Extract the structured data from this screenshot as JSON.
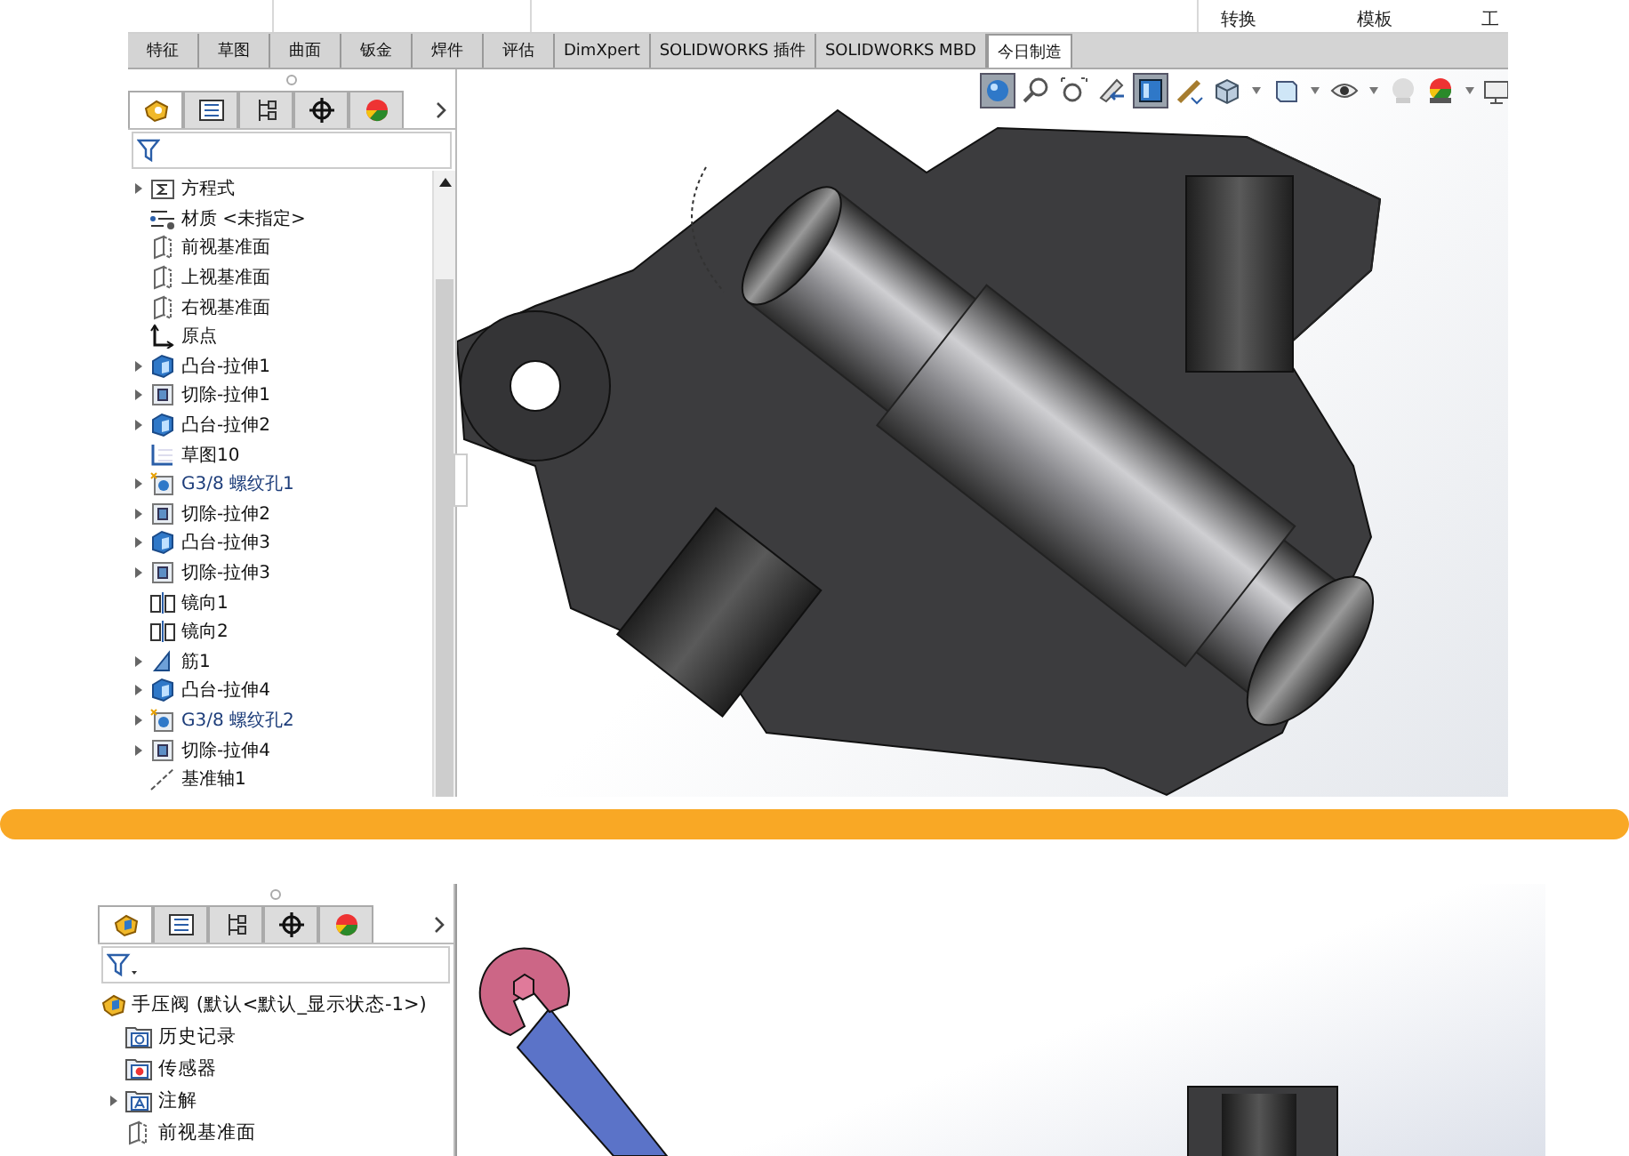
{
  "top_window": {
    "ribbon_labels": [
      "转换",
      "模板",
      "工"
    ],
    "tabs": [
      {
        "label": "特征",
        "selected": false
      },
      {
        "label": "草图",
        "selected": false
      },
      {
        "label": "曲面",
        "selected": false
      },
      {
        "label": "钣金",
        "selected": false
      },
      {
        "label": "焊件",
        "selected": false
      },
      {
        "label": "评估",
        "selected": false
      },
      {
        "label": "DimXpert",
        "selected": false
      },
      {
        "label": "SOLIDWORKS 插件",
        "selected": false
      },
      {
        "label": "SOLIDWORKS MBD",
        "selected": false
      },
      {
        "label": "今日制造",
        "selected": true
      }
    ],
    "panel_tabs": [
      {
        "kind": "part",
        "selected": true
      },
      {
        "kind": "property",
        "selected": false
      },
      {
        "kind": "config",
        "selected": false
      },
      {
        "kind": "origin",
        "selected": false
      },
      {
        "kind": "appearance",
        "selected": false
      }
    ],
    "tree": [
      {
        "label": "方程式",
        "kind": "equation",
        "expandable": true
      },
      {
        "label": "材质 <未指定>",
        "kind": "material",
        "expandable": false
      },
      {
        "label": "前视基准面",
        "kind": "plane",
        "expandable": false
      },
      {
        "label": "上视基准面",
        "kind": "plane",
        "expandable": false
      },
      {
        "label": "右视基准面",
        "kind": "plane",
        "expandable": false
      },
      {
        "label": "原点",
        "kind": "origin",
        "expandable": false
      },
      {
        "label": "凸台-拉伸1",
        "kind": "boss",
        "expandable": true
      },
      {
        "label": "切除-拉伸1",
        "kind": "cut",
        "expandable": true
      },
      {
        "label": "凸台-拉伸2",
        "kind": "boss",
        "expandable": true
      },
      {
        "label": "草图10",
        "kind": "sketch",
        "expandable": false
      },
      {
        "label": "G3/8 螺纹孔1",
        "kind": "hole",
        "expandable": true
      },
      {
        "label": "切除-拉伸2",
        "kind": "cut",
        "expandable": true
      },
      {
        "label": "凸台-拉伸3",
        "kind": "boss",
        "expandable": true
      },
      {
        "label": "切除-拉伸3",
        "kind": "cut",
        "expandable": true
      },
      {
        "label": "镜向1",
        "kind": "mirror",
        "expandable": false
      },
      {
        "label": "镜向2",
        "kind": "mirror",
        "expandable": false
      },
      {
        "label": "筋1",
        "kind": "rib",
        "expandable": true
      },
      {
        "label": "凸台-拉伸4",
        "kind": "boss",
        "expandable": true
      },
      {
        "label": "G3/8 螺纹孔2",
        "kind": "hole",
        "expandable": true
      },
      {
        "label": "切除-拉伸4",
        "kind": "cut",
        "expandable": true
      },
      {
        "label": "基准轴1",
        "kind": "axis",
        "expandable": false
      }
    ]
  },
  "bottom_window": {
    "panel_tabs": [
      {
        "kind": "part",
        "selected": true
      },
      {
        "kind": "property",
        "selected": false
      },
      {
        "kind": "config",
        "selected": false
      },
      {
        "kind": "origin",
        "selected": false
      },
      {
        "kind": "appearance",
        "selected": false
      }
    ],
    "tree": [
      {
        "label": "手压阀  (默认<默认_显示状态-1>)",
        "kind": "assembly",
        "children": [
          {
            "label": "历史记录",
            "kind": "history",
            "expandable": false
          },
          {
            "label": "传感器",
            "kind": "sensor",
            "expandable": false
          },
          {
            "label": "注解",
            "kind": "annotation",
            "expandable": true
          },
          {
            "label": "前视基准面",
            "kind": "plane",
            "expandable": false
          }
        ]
      }
    ]
  }
}
